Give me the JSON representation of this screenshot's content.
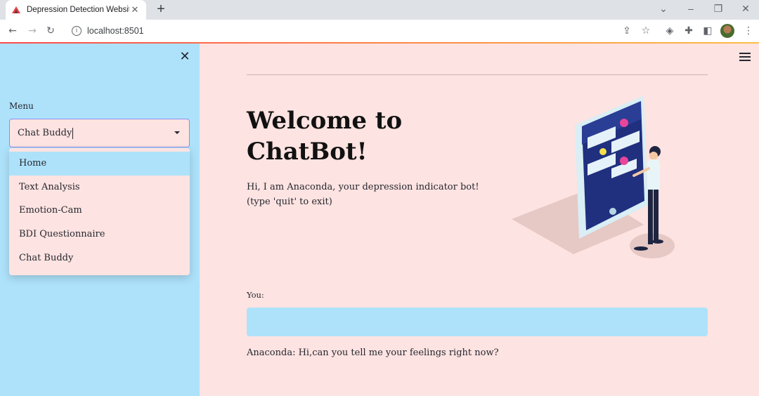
{
  "browser": {
    "tab_title": "Depression Detection Website",
    "tab_close": "✕",
    "new_tab": "+",
    "url": "localhost:8501",
    "address_info": "i"
  },
  "sidebar": {
    "close_glyph": "✕",
    "menu_label": "Menu",
    "selected_value": "Chat Buddy",
    "options": [
      "Home",
      "Text Analysis",
      "Emotion-Cam",
      "BDI Questionnaire",
      "Chat Buddy"
    ]
  },
  "main": {
    "title": "Welcome to ChatBot!",
    "intro_line1": "Hi, I am Anaconda, your depression indicator bot!",
    "intro_line2": "(type 'quit' to exit)",
    "you_label": "You:",
    "input_value": "",
    "reply": "Anaconda: Hi,can you tell me your feelings right now?"
  },
  "colors": {
    "sidebar_bg": "#aee2fb",
    "main_bg": "#fde3e1",
    "select_border": "#8b8ff0",
    "accent_gradient_start": "#ff4b4b",
    "accent_gradient_end": "#ffbd45"
  },
  "icons": {
    "back": "arrow-left-icon",
    "forward": "arrow-right-icon",
    "reload": "reload-icon",
    "share": "share-icon",
    "bookmark": "star-icon",
    "extensions": "puzzle-icon",
    "sidepanel": "side-panel-icon",
    "more": "kebab-menu-icon",
    "hamburger": "hamburger-menu-icon"
  }
}
